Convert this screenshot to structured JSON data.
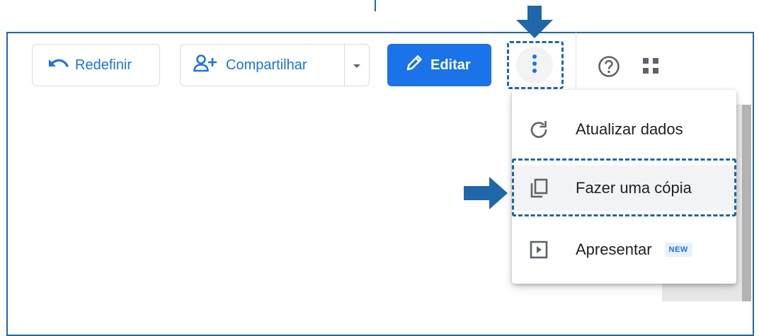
{
  "toolbar": {
    "reset_label": "Redefinir",
    "share_label": "Compartilhar",
    "edit_label": "Editar"
  },
  "menu": {
    "items": [
      {
        "label": "Atualizar dados",
        "icon": "refresh-icon"
      },
      {
        "label": "Fazer uma cópia",
        "icon": "copy-icon"
      },
      {
        "label": "Apresentar",
        "icon": "present-icon",
        "badge": "NEW"
      }
    ]
  },
  "colors": {
    "accent": "#1a73e8",
    "annotation": "#1f67a8",
    "text": "#202124"
  },
  "icons": [
    "undo-icon",
    "add-person-icon",
    "chevron-down-icon",
    "pencil-icon",
    "more-vert-icon",
    "help-icon",
    "apps-icon"
  ]
}
